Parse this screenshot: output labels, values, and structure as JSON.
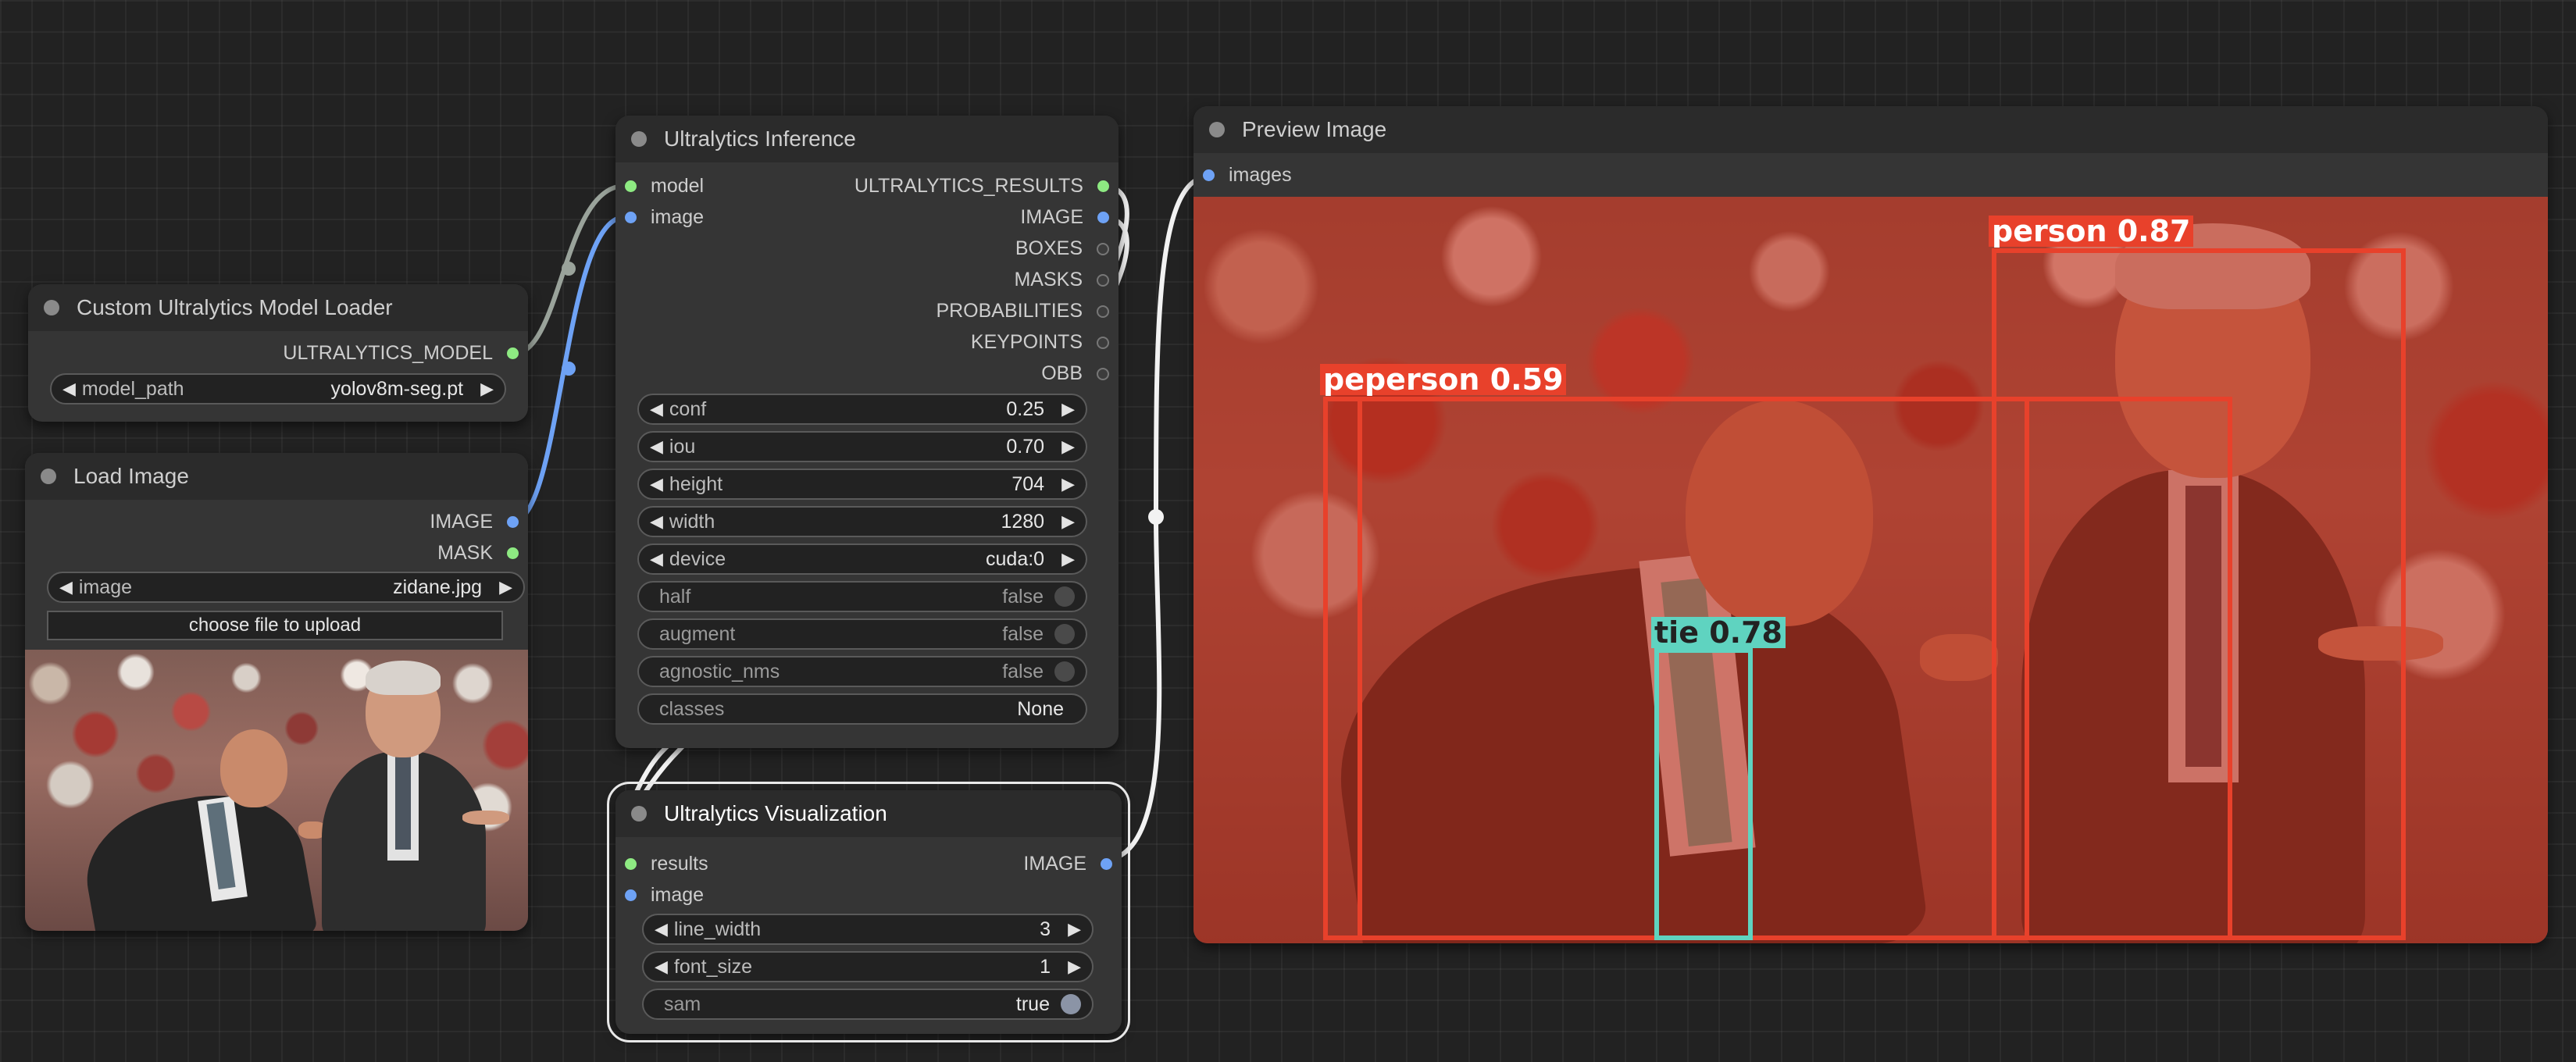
{
  "canvas": {
    "link_color_model": "#9aa39b",
    "link_color_image": "#6ea2f5",
    "link_color_white": "#f2f2f2"
  },
  "model_loader": {
    "title": "Custom Ultralytics Model Loader",
    "output": "ULTRALYTICS_MODEL",
    "widget_label": "model_path",
    "widget_value": "yolov8m-seg.pt"
  },
  "load_image": {
    "title": "Load Image",
    "outputs": [
      "IMAGE",
      "MASK"
    ],
    "widget_label": "image",
    "widget_value": "zidane.jpg",
    "upload_label": "choose file to upload"
  },
  "inference": {
    "title": "Ultralytics Inference",
    "inputs": [
      "model",
      "image"
    ],
    "outputs": [
      "ULTRALYTICS_RESULTS",
      "IMAGE",
      "BOXES",
      "MASKS",
      "PROBABILITIES",
      "KEYPOINTS",
      "OBB"
    ],
    "widgets": [
      {
        "label": "conf",
        "value": "0.25"
      },
      {
        "label": "iou",
        "value": "0.70"
      },
      {
        "label": "height",
        "value": "704"
      },
      {
        "label": "width",
        "value": "1280"
      },
      {
        "label": "device",
        "value": "cuda:0"
      }
    ],
    "toggles": [
      {
        "label": "half",
        "value": "false"
      },
      {
        "label": "augment",
        "value": "false"
      },
      {
        "label": "agnostic_nms",
        "value": "false"
      }
    ],
    "text_widget": {
      "label": "classes",
      "value": "None"
    }
  },
  "visualization": {
    "title": "Ultralytics Visualization",
    "inputs": [
      "results",
      "image"
    ],
    "output": "IMAGE",
    "widgets": [
      {
        "label": "line_width",
        "value": "3"
      },
      {
        "label": "font_size",
        "value": "1"
      }
    ],
    "toggle": {
      "label": "sam",
      "value": "true"
    }
  },
  "preview": {
    "title": "Preview Image",
    "input": "images",
    "detections": [
      {
        "label": "person 0.87",
        "color": "#e8412b"
      },
      {
        "label": "peperson  0.59",
        "color": "#e8412b"
      },
      {
        "label": "tie 0.78",
        "color": "#5fd3c0"
      }
    ]
  }
}
